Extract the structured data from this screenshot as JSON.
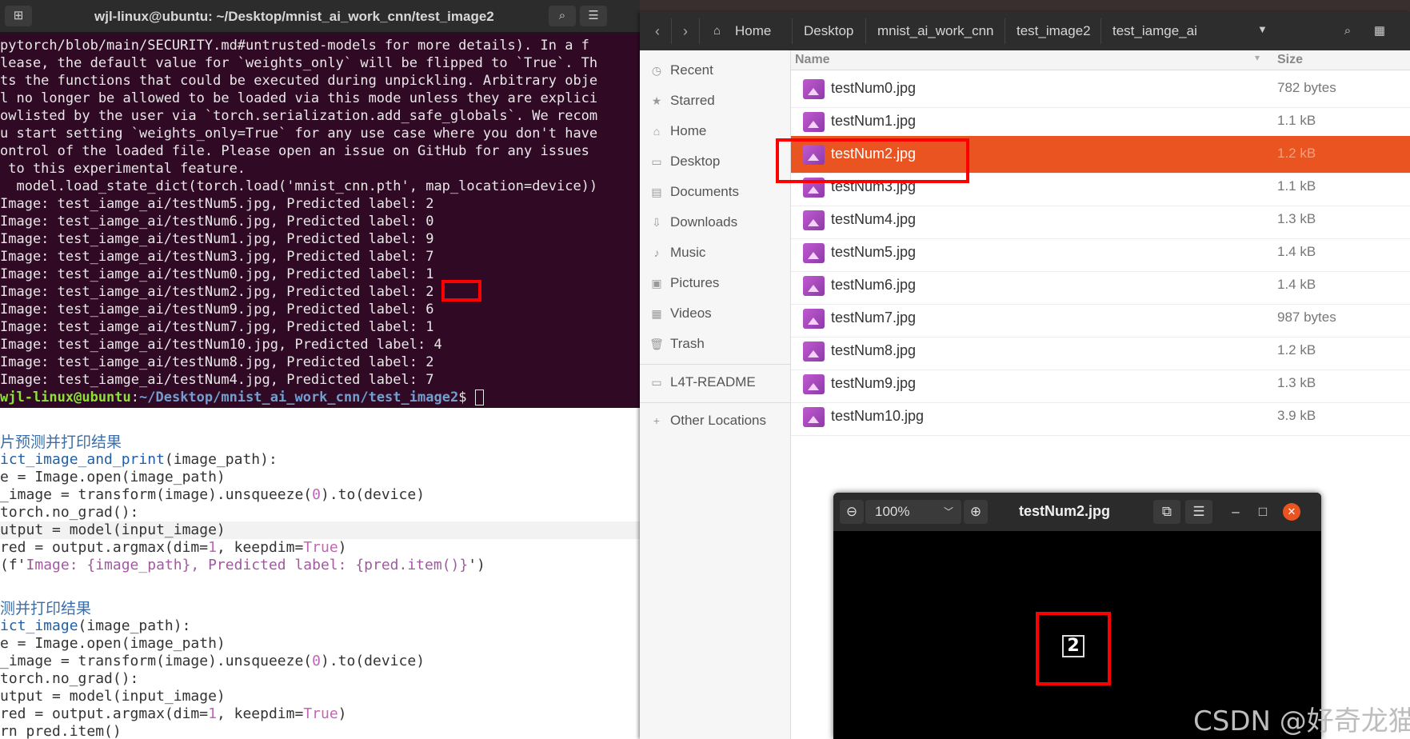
{
  "terminal": {
    "title": "wjl-linux@ubuntu: ~/Desktop/mnist_ai_work_cnn/test_image2",
    "lines": [
      "pytorch/blob/main/SECURITY.md#untrusted-models for more details). In a f",
      "lease, the default value for `weights_only` will be flipped to `True`. Th",
      "ts the functions that could be executed during unpickling. Arbitrary obje",
      "l no longer be allowed to be loaded via this mode unless they are explici",
      "owlisted by the user via `torch.serialization.add_safe_globals`. We recom",
      "u start setting `weights_only=True` for any use case where you don't have",
      "ontrol of the loaded file. Please open an issue on GitHub for any issues",
      " to this experimental feature.",
      "  model.load_state_dict(torch.load('mnist_cnn.pth', map_location=device))",
      "Image: test_iamge_ai/testNum5.jpg, Predicted label: 2",
      "Image: test_iamge_ai/testNum6.jpg, Predicted label: 0",
      "Image: test_iamge_ai/testNum1.jpg, Predicted label: 9",
      "Image: test_iamge_ai/testNum3.jpg, Predicted label: 7",
      "Image: test_iamge_ai/testNum0.jpg, Predicted label: 1",
      "Image: test_iamge_ai/testNum2.jpg, Predicted label: 2",
      "Image: test_iamge_ai/testNum9.jpg, Predicted label: 6",
      "Image: test_iamge_ai/testNum7.jpg, Predicted label: 1",
      "Image: test_iamge_ai/testNum10.jpg, Predicted label: 4",
      "Image: test_iamge_ai/testNum8.jpg, Predicted label: 2",
      "Image: test_iamge_ai/testNum4.jpg, Predicted label: 7"
    ],
    "prompt_user": "wjl-linux@ubuntu",
    "prompt_sep": ":",
    "prompt_path": "~/Desktop/mnist_ai_work_cnn/test_image2",
    "prompt_end": "$ "
  },
  "editor": {
    "comment1": "片预测并打印结果",
    "l1_fn": "ict_image_and_print",
    "l1_rest": "(image_path):",
    "l2": "e = Image.open(image_path)",
    "l3_a": "_image = transform(image).unsqueeze(",
    "l3_num": "0",
    "l3_b": ").to(device)",
    "l4": "torch.no_grad():",
    "l5": "utput = model(input_image)",
    "l6_a": "red = output.argmax(dim=",
    "l6_num": "1",
    "l6_b": ", keepdim=",
    "l6_kw": "True",
    "l6_c": ")",
    "l7_a": "(f'",
    "l7_str": "Image: {image_path}, Predicted label: {pred.item()}",
    "l7_b": "')",
    "comment2": "测并打印结果",
    "l8_fn": "ict_image",
    "l8_rest": "(image_path):",
    "l9": "e = Image.open(image_path)",
    "l10_a": "_image = transform(image).unsqueeze(",
    "l10_num": "0",
    "l10_b": ").to(device)",
    "l11": "torch.no_grad():",
    "l12": "utput = model(input_image)",
    "l13_a": "red = output.argmax(dim=",
    "l13_num": "1",
    "l13_b": ", keepdim=",
    "l13_kw": "True",
    "l13_c": ")",
    "l14": "rn pred.item()"
  },
  "files": {
    "breadcrumbs": [
      "Home",
      "Desktop",
      "mnist_ai_work_cnn",
      "test_image2",
      "test_iamge_ai"
    ],
    "sidebar": [
      "Recent",
      "Starred",
      "Home",
      "Desktop",
      "Documents",
      "Downloads",
      "Music",
      "Pictures",
      "Videos",
      "Trash",
      "L4T-README",
      "Other Locations"
    ],
    "columns": {
      "name": "Name",
      "size": "Size"
    },
    "rows": [
      {
        "name": "testNum0.jpg",
        "size": "782 bytes"
      },
      {
        "name": "testNum1.jpg",
        "size": "1.1 kB"
      },
      {
        "name": "testNum2.jpg",
        "size": "1.2 kB"
      },
      {
        "name": "testNum3.jpg",
        "size": "1.1 kB"
      },
      {
        "name": "testNum4.jpg",
        "size": "1.3 kB"
      },
      {
        "name": "testNum5.jpg",
        "size": "1.4 kB"
      },
      {
        "name": "testNum6.jpg",
        "size": "1.4 kB"
      },
      {
        "name": "testNum7.jpg",
        "size": "987 bytes"
      },
      {
        "name": "testNum8.jpg",
        "size": "1.2 kB"
      },
      {
        "name": "testNum9.jpg",
        "size": "1.3 kB"
      },
      {
        "name": "testNum10.jpg",
        "size": "3.9 kB"
      }
    ],
    "selected_row": 2
  },
  "viewer": {
    "zoom": "100%",
    "title": "testNum2.jpg",
    "digit": "2"
  },
  "watermark": "CSDN @好奇龙猫",
  "colors": {
    "terminal_bg": "#300a24",
    "selection": "#e95420",
    "highlight": "#ff0000"
  }
}
